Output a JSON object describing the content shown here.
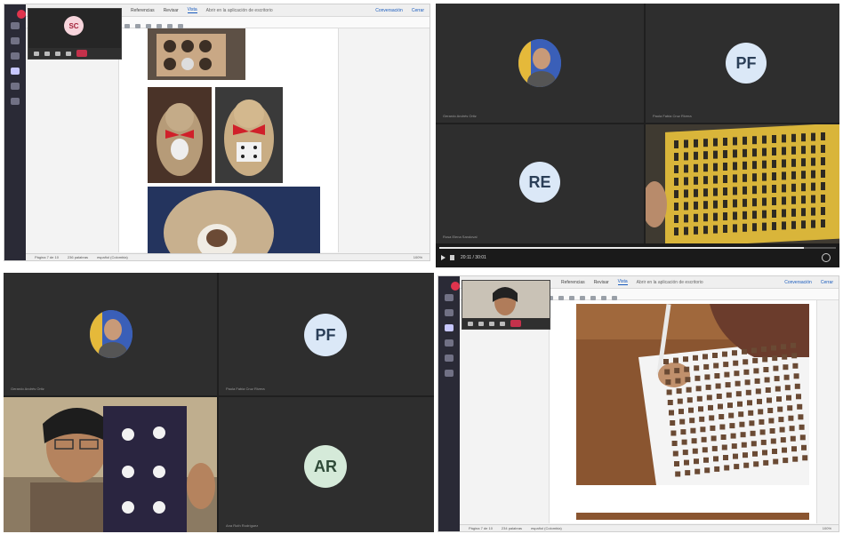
{
  "panel_tl": {
    "word_tabs": [
      "Referencias",
      "Revisar",
      "Vista"
    ],
    "word_active_tab": "Vista",
    "search_hint": "Abrir en la aplicación de escritorio",
    "buttons": {
      "conversation": "Conversación",
      "close": "Cerrar"
    },
    "status": {
      "left": "Página 7 de 10",
      "words": "236 palabras",
      "lang": "español (Colombia)",
      "zoom": "100%"
    },
    "mini_call_initials": "SC"
  },
  "panel_tr": {
    "participants": [
      {
        "name": "Gerardo Andrés Ortiz",
        "kind": "photo"
      },
      {
        "name": "Paola Fabia Cruz Rivera",
        "initials": "PF",
        "kind": "initials"
      },
      {
        "name": "Rosa Elena Sandoval",
        "initials": "RE",
        "kind": "initials"
      },
      {
        "name": "",
        "kind": "video"
      }
    ],
    "player": {
      "time": "20:11 / 30:01",
      "progress": 0.92
    }
  },
  "panel_bl": {
    "participants": [
      {
        "name": "Gerardo Andrés Ortiz",
        "kind": "photo"
      },
      {
        "name": "Paola Fabia Cruz Rivera",
        "initials": "PF",
        "kind": "initials"
      },
      {
        "name": "",
        "kind": "video"
      },
      {
        "name": "Ana Ruth Rodríguez",
        "initials": "AR",
        "kind": "initials"
      }
    ]
  },
  "panel_br": {
    "word_tabs": [
      "Referencias",
      "Revisar",
      "Vista"
    ],
    "word_active_tab": "Vista",
    "search_hint": "Abrir en la aplicación de escritorio",
    "buttons": {
      "conversation": "Conversación",
      "close": "Cerrar"
    },
    "status": {
      "left": "Página 7 de 10",
      "words": "234 palabras",
      "lang": "español (Colombia)",
      "zoom": "100%"
    }
  },
  "colors": {
    "accent": "#185abd",
    "teams_rail": "#2a2a36",
    "hangup": "#c4314b",
    "tile_bg": "#2e2e2e",
    "braille_yellow": "#d9b53a"
  },
  "icons": [
    "chat-icon",
    "teams-icon",
    "calendar-icon",
    "calls-icon",
    "files-icon",
    "play-icon",
    "mic-icon",
    "camera-icon",
    "hangup-icon"
  ]
}
